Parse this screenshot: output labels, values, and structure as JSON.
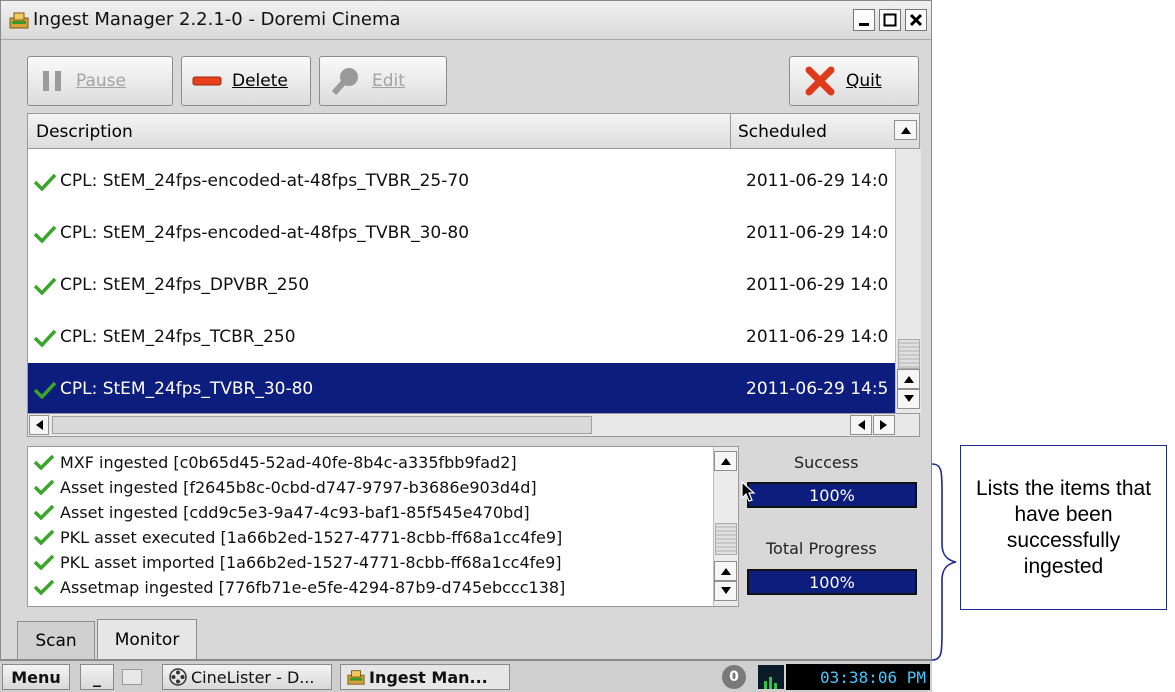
{
  "window": {
    "title": "Ingest Manager 2.2.1-0 - Doremi Cinema",
    "controls": [
      "_",
      "□",
      "✕"
    ]
  },
  "toolbar": {
    "pause_label": "Pause",
    "delete_label": "Delete",
    "edit_label": "Edit",
    "quit_label": "Quit"
  },
  "list": {
    "columns": [
      "Description",
      "Scheduled"
    ],
    "rows": [
      {
        "description": "CPL: StEM_24fps-encoded-at-48fps_TVBR_25-70",
        "scheduled": "2011-06-29 14:0"
      },
      {
        "description": "CPL: StEM_24fps-encoded-at-48fps_TVBR_30-80",
        "scheduled": "2011-06-29 14:0"
      },
      {
        "description": "CPL: StEM_24fps_DPVBR_250",
        "scheduled": "2011-06-29 14:0"
      },
      {
        "description": "CPL: StEM_24fps_TCBR_250",
        "scheduled": "2011-06-29 14:0"
      },
      {
        "description": "CPL: StEM_24fps_TVBR_30-80",
        "scheduled": "2011-06-29 14:5",
        "selected": true
      }
    ]
  },
  "log": {
    "lines": [
      "MXF ingested [c0b65d45-52ad-40fe-8b4c-a335fbb9fad2]",
      "Asset ingested [f2645b8c-0cbd-d747-9797-b3686e903d4d]",
      "Asset ingested [cdd9c5e3-9a47-4c93-baf1-85f545e470bd]",
      "PKL asset executed [1a66b2ed-1527-4771-8cbb-ff68a1cc4fe9]",
      "PKL asset imported [1a66b2ed-1527-4771-8cbb-ff68a1cc4fe9]",
      "Assetmap ingested [776fb71e-e5fe-4294-87b9-d745ebccc138]"
    ]
  },
  "status": {
    "success_label": "Success",
    "success_value": "100%",
    "total_label": "Total Progress",
    "total_value": "100%"
  },
  "tabs": [
    "Scan",
    "Monitor"
  ],
  "taskbar": {
    "menu_label": "Menu",
    "min_label": "_",
    "app1_label": "CineLister - D...",
    "app2_label": "Ingest Man...",
    "badge": "0",
    "clock": "03:38:06 PM"
  },
  "callout": {
    "text": "Lists the items that have been successfully ingested"
  },
  "colors": {
    "selection": "#0c1d7e",
    "check": "#3aa52a",
    "quit_x": "#e03a1c",
    "delete_bar": "#e8401a"
  }
}
